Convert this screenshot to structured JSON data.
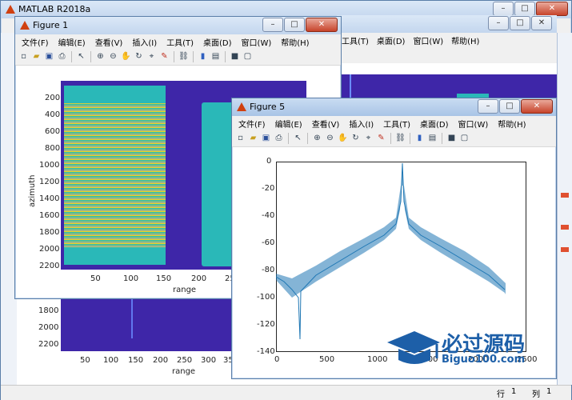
{
  "matlab": {
    "title": "MATLAB R2018a",
    "status_row_label": "行",
    "status_row": "1",
    "status_col_label": "列",
    "status_col": "1"
  },
  "menu": [
    "文件(F)",
    "编辑(E)",
    "查看(V)",
    "插入(I)",
    "工具(T)",
    "桌面(D)",
    "窗口(W)",
    "帮助(H)"
  ],
  "figure1": {
    "title": "Figure 1",
    "ylabel": "azimuth",
    "xlabel": "range",
    "yticks": [
      "200",
      "400",
      "600",
      "800",
      "1000",
      "1200",
      "1400",
      "1600",
      "1800",
      "2000",
      "2200"
    ],
    "xticks": [
      "50",
      "100",
      "150",
      "200",
      "250"
    ]
  },
  "bgfig": {
    "yticks": [
      "1800",
      "2000",
      "2200"
    ],
    "xticks": [
      "50",
      "100",
      "150",
      "200",
      "250",
      "300",
      "350"
    ],
    "xlabel": "range"
  },
  "figure5": {
    "title": "Figure 5",
    "yticks": [
      "0",
      "-20",
      "-40",
      "-60",
      "-80",
      "-100",
      "-120",
      "-140"
    ],
    "xticks": [
      "0",
      "500",
      "1000",
      "1500",
      "2000",
      "2500"
    ]
  },
  "watermark": {
    "text_cn": "必过源码",
    "text_url": "Biguo100.com"
  },
  "colors": {
    "parula_bg": "#3e26a8",
    "teal": "#2ab8b8",
    "line": "#1f77b4"
  }
}
